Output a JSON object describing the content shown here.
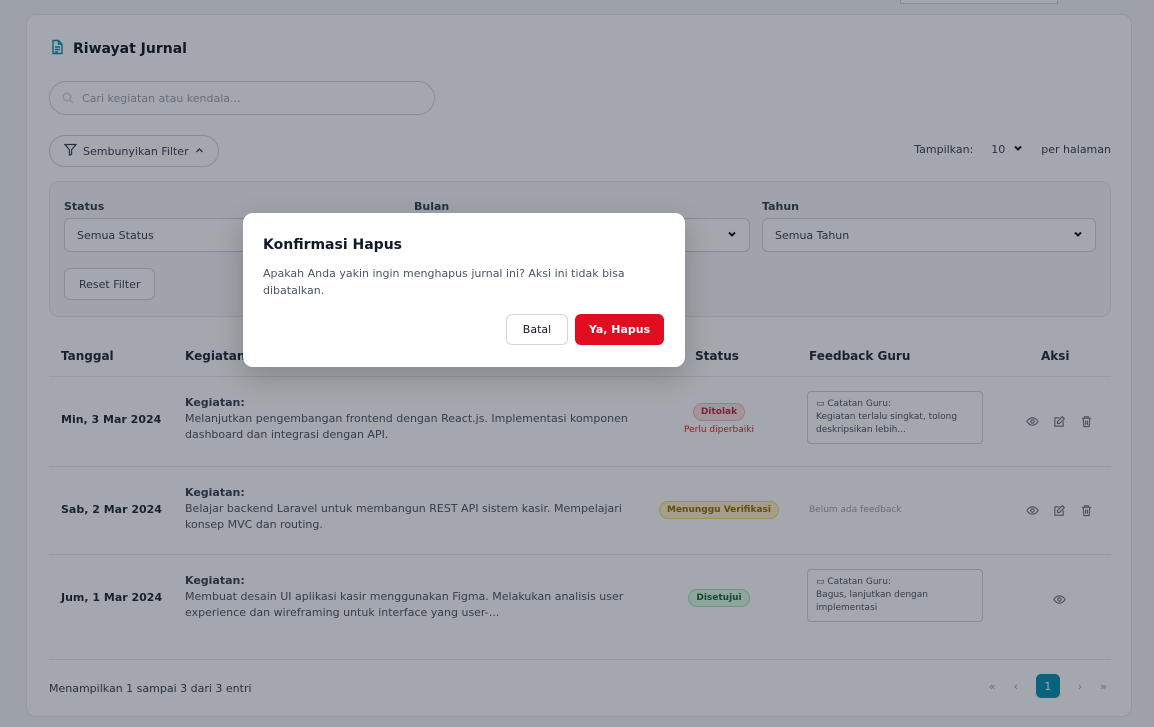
{
  "page": {
    "title": "Riwayat Jurnal",
    "title_icon": "document-icon"
  },
  "search": {
    "placeholder": "Cari kegiatan atau kendala...",
    "icon": "search-icon"
  },
  "filter_toggle": {
    "label": "Sembunyikan Filter",
    "icon": "filter-icon",
    "chevron": "chevron-up-icon"
  },
  "per_page": {
    "prefix": "Tampilkan:",
    "value": "10",
    "suffix": "per halaman"
  },
  "filters": {
    "status": {
      "label": "Status",
      "value": "Semua Status"
    },
    "bulan": {
      "label": "Bulan",
      "value": ""
    },
    "tahun": {
      "label": "Tahun",
      "value": "Semua Tahun"
    },
    "reset_label": "Reset Filter"
  },
  "table": {
    "headers": {
      "tanggal": "Tanggal",
      "kegiatan": "Kegiatan",
      "status": "Status",
      "feedback": "Feedback Guru",
      "aksi": "Aksi"
    },
    "rows": [
      {
        "date": "Min, 3 Mar 2024",
        "activity_label": "Kegiatan:",
        "activity": "Melanjutkan pengembangan frontend dengan React.js. Implementasi komponen dashboard dan integrasi dengan API.",
        "status": "Ditolak",
        "status_note": "Perlu diperbaiki",
        "feedback_title": "Catatan Guru:",
        "feedback": "Kegiatan terlalu singkat, tolong deskripsikan lebih..."
      },
      {
        "date": "Sab, 2 Mar 2024",
        "activity_label": "Kegiatan:",
        "activity": "Belajar backend Laravel untuk membangun REST API sistem kasir. Mempelajari konsep MVC dan routing.",
        "status": "Menunggu Verifikasi",
        "feedback_none": "Belum ada feedback"
      },
      {
        "date": "Jum, 1 Mar 2024",
        "activity_label": "Kegiatan:",
        "activity": "Membuat desain UI aplikasi kasir menggunakan Figma. Melakukan analisis user experience dan wireframing untuk interface yang user-...",
        "status": "Disetujui",
        "feedback_title": "Catatan Guru:",
        "feedback": "Bagus, lanjutkan dengan implementasi"
      }
    ]
  },
  "footer": {
    "info": "Menampilkan 1 sampai 3 dari 3 entri",
    "pager": {
      "first": "«",
      "prev": "‹",
      "current": "1",
      "next": "›",
      "last": "»"
    }
  },
  "modal": {
    "title": "Konfirmasi Hapus",
    "message": "Apakah Anda yakin ingin menghapus jurnal ini? Aksi ini tidak bisa dibatalkan.",
    "cancel_label": "Batal",
    "confirm_label": "Ya, Hapus"
  },
  "colors": {
    "primary": "#0891b2",
    "danger": "#e10c1f",
    "status_rejected": "#c0264a",
    "status_pending": "#92700c",
    "status_approved": "#166534"
  }
}
